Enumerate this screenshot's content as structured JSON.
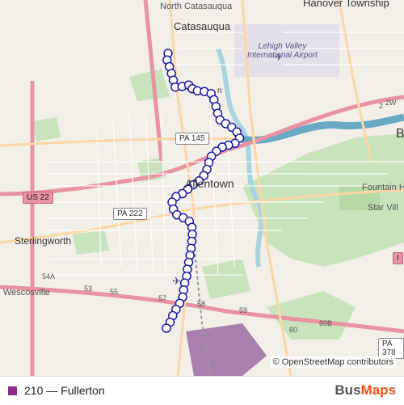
{
  "map": {
    "labels": {
      "north_catasauqua": "North Catasauqua",
      "catasauqua": "Catasauqua",
      "hanover": "Hanover Township",
      "airport": "Lehigh Valley International Airport",
      "allentown": "Allentown",
      "fountain_hill": "Fountain Hil",
      "star_village": "Star Vill",
      "sterlingworth": "Sterlingworth",
      "wescosville": "Wescosville",
      "bethlehem_initial": "B",
      "center_cut": "n"
    },
    "shields": {
      "pa145": "PA 145",
      "us22": "US 22",
      "pa222": "PA 222",
      "pa378": "PA 378",
      "i78": "I",
      "exit_2w": "2W",
      "exit_2": "2",
      "exit_53": "53",
      "exit_54a": "54A",
      "exit_55": "55",
      "exit_57": "57",
      "exit_58": "58",
      "exit_59": "59",
      "exit_60": "60",
      "exit_60b": "60B"
    },
    "attribution": "© OpenStreetMap contributors",
    "route_color": "#1a1aa6",
    "stop_count": 54
  },
  "footer": {
    "route_label": "210 — Fullerton",
    "route_swatch_color": "#8b2b8b",
    "brand_part1": "Bus",
    "brand_part2": "Maps",
    "brand_color": "#e8531f"
  }
}
